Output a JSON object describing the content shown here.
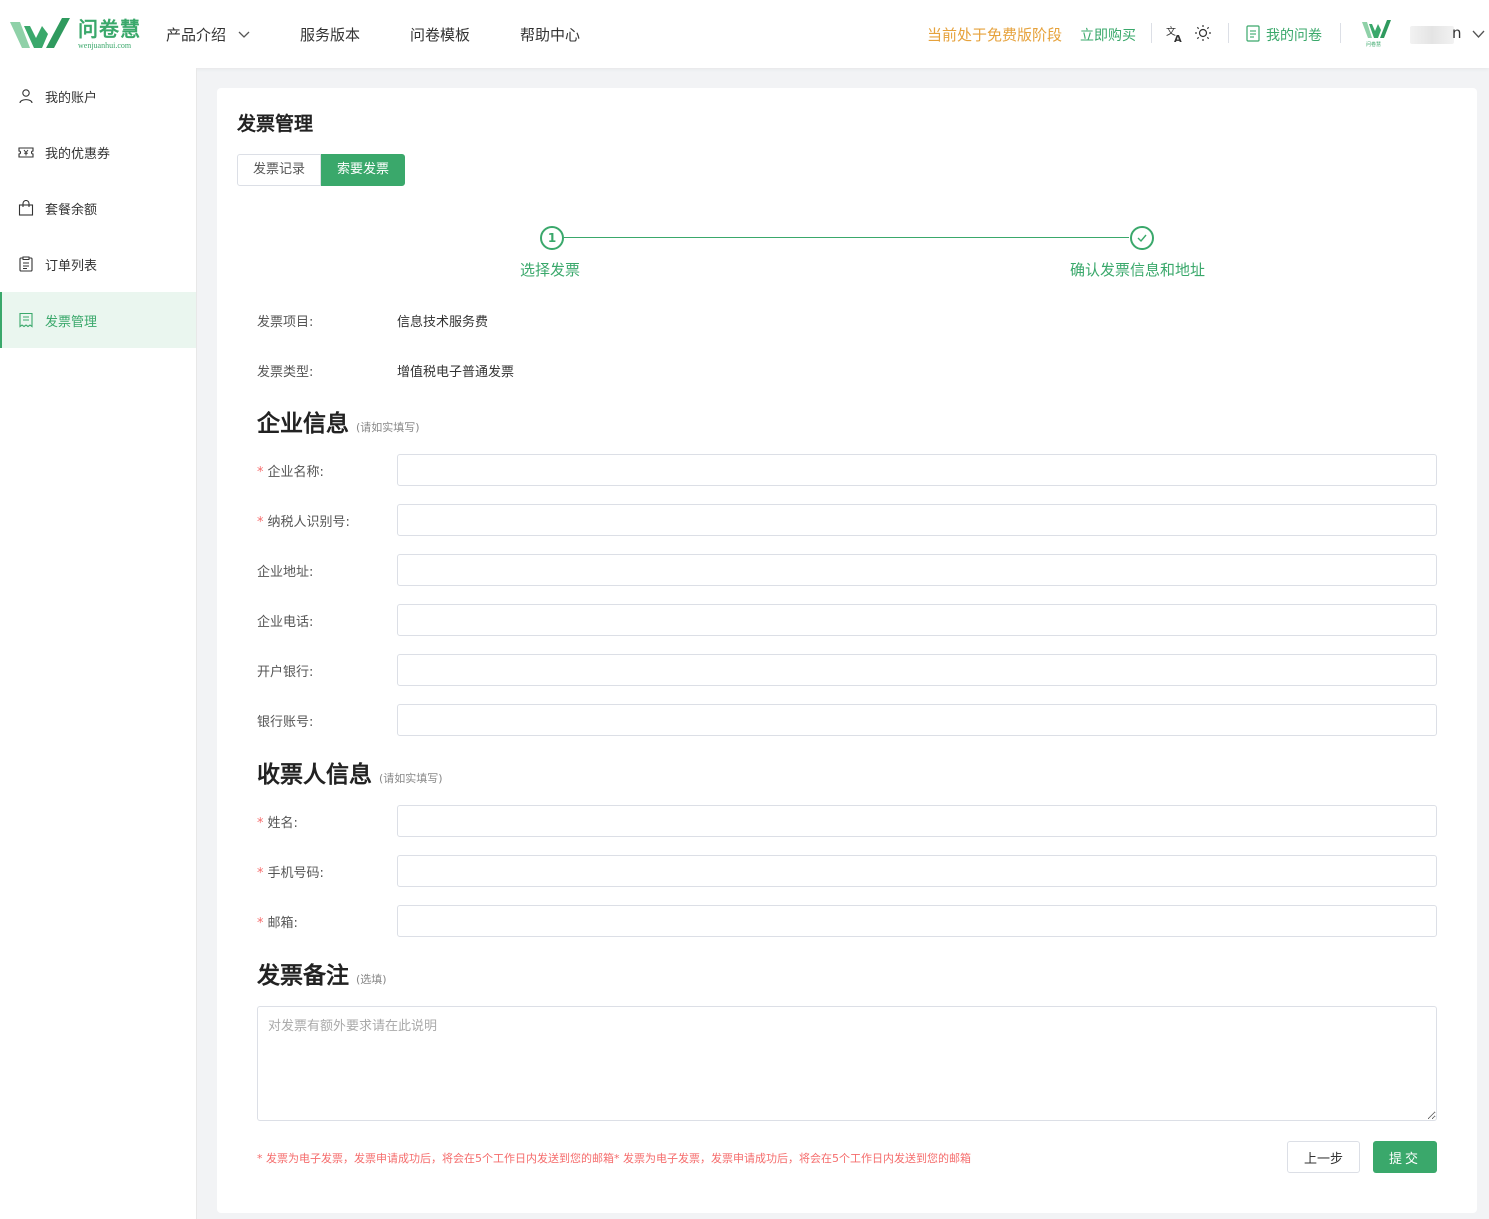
{
  "header": {
    "logo_cn": "问卷慧",
    "logo_en": "wenjuanhui.com",
    "nav": [
      "产品介绍",
      "服务版本",
      "问卷模板",
      "帮助中心"
    ],
    "free_notice": "当前处于免费版阶段",
    "buy_link": "立即购买",
    "my_survey": "我的问卷",
    "username": "n"
  },
  "sidebar": {
    "items": [
      {
        "label": "我的账户",
        "icon": "user-icon"
      },
      {
        "label": "我的优惠券",
        "icon": "coupon-icon"
      },
      {
        "label": "套餐余额",
        "icon": "bag-icon"
      },
      {
        "label": "订单列表",
        "icon": "list-icon"
      },
      {
        "label": "发票管理",
        "icon": "invoice-icon",
        "active": true
      }
    ]
  },
  "main": {
    "title": "发票管理",
    "tabs": [
      "发票记录",
      "索要发票"
    ],
    "active_tab": "索要发票",
    "steps": [
      {
        "number": "1",
        "label": "选择发票"
      },
      {
        "label": "确认发票信息和地址"
      }
    ],
    "info": [
      {
        "label": "发票项目:",
        "value": "信息技术服务费"
      },
      {
        "label": "发票类型:",
        "value": "增值税电子普通发票"
      }
    ],
    "company_section": {
      "title": "企业信息",
      "hint": "(请如实填写)"
    },
    "company_fields": [
      {
        "label": "企业名称:",
        "required": true,
        "value": ""
      },
      {
        "label": "纳税人识别号:",
        "required": true,
        "value": ""
      },
      {
        "label": "企业地址:",
        "required": false,
        "value": ""
      },
      {
        "label": "企业电话:",
        "required": false,
        "value": ""
      },
      {
        "label": "开户银行:",
        "required": false,
        "value": ""
      },
      {
        "label": "银行账号:",
        "required": false,
        "value": ""
      }
    ],
    "receiver_section": {
      "title": "收票人信息",
      "hint": "(请如实填写)"
    },
    "receiver_fields": [
      {
        "label": "姓名:",
        "required": true,
        "value": ""
      },
      {
        "label": "手机号码:",
        "required": true,
        "value": ""
      },
      {
        "label": "邮箱:",
        "required": true,
        "value": ""
      }
    ],
    "remark_section": {
      "title": "发票备注",
      "hint": "(选填)"
    },
    "remark_placeholder": "对发票有额外要求请在此说明",
    "notice": "* 发票为电子发票，发票申请成功后，将会在5个工作日内发送到您的邮箱* 发票为电子发票，发票申请成功后，将会在5个工作日内发送到您的邮箱",
    "required_mark": "*",
    "prev_button": "上一步",
    "submit_button": "提交"
  },
  "colors": {
    "accent": "#3aa86b",
    "warning": "#e6a23c",
    "danger": "#f56c6c"
  }
}
